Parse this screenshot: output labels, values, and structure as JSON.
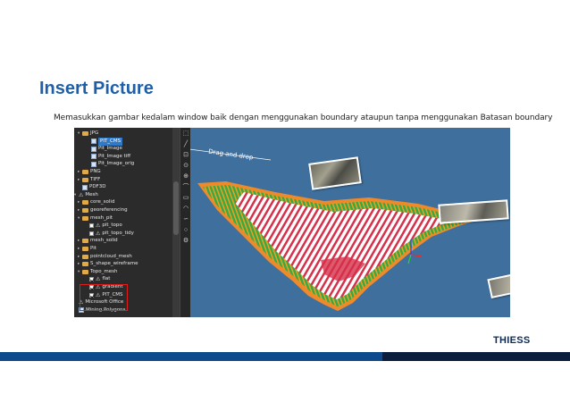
{
  "slide": {
    "title": "Insert Picture",
    "subtitle": "Memasukkan gambar kedalam window baik dengan menggunakan boundary ataupun tanpa menggunakan Batasan boundary",
    "logo": "THIESS"
  },
  "tree": {
    "items": [
      {
        "label": "JPG",
        "icon": "folder-icon",
        "arrow": "expanded"
      },
      {
        "label": "PIT_CMS",
        "icon": "image-file-icon",
        "selected": true
      },
      {
        "label": "Pit_Image",
        "icon": "image-file-icon"
      },
      {
        "label": "Pit_Image tiff",
        "icon": "image-file-icon"
      },
      {
        "label": "Pit_Image_orig",
        "icon": "image-file-icon"
      },
      {
        "label": "PNG",
        "icon": "folder-icon",
        "arrow": "collapsed"
      },
      {
        "label": "TIFF",
        "icon": "folder-icon",
        "arrow": "collapsed"
      },
      {
        "label": "PDF3D",
        "icon": "file-icon"
      },
      {
        "label": "Mesh",
        "icon": "mesh-icon",
        "arrow": "expanded"
      },
      {
        "label": "core_solid",
        "icon": "folder-icon",
        "arrow": "collapsed"
      },
      {
        "label": "georeferencing",
        "icon": "folder-icon",
        "arrow": "collapsed"
      },
      {
        "label": "mesh_pit",
        "icon": "folder-icon",
        "arrow": "expanded"
      },
      {
        "label": "pit_topo",
        "icon": "mesh-icon",
        "checkbox": false
      },
      {
        "label": "pit_topo_tidy",
        "icon": "mesh-icon",
        "checkbox": false
      },
      {
        "label": "mesh_solid",
        "icon": "folder-icon",
        "arrow": "collapsed"
      },
      {
        "label": "Pit",
        "icon": "folder-icon",
        "arrow": "collapsed"
      },
      {
        "label": "pointcloud_mesh",
        "icon": "folder-icon",
        "arrow": "collapsed"
      },
      {
        "label": "S_shape_wireframe",
        "icon": "folder-icon",
        "arrow": "collapsed"
      },
      {
        "label": "Topo_mesh",
        "icon": "folder-icon",
        "arrow": "expanded"
      },
      {
        "label": "flat",
        "icon": "mesh-icon",
        "checkbox": true
      },
      {
        "label": "gradient",
        "icon": "mesh-icon",
        "checkbox": true
      },
      {
        "label": "PIT_CMS",
        "icon": "mesh-icon",
        "checkbox": true
      },
      {
        "label": "Microsoft Office",
        "icon": "mesh-icon"
      },
      {
        "label": "Mining Polygons",
        "icon": "file-icon"
      }
    ]
  },
  "viewport": {
    "annotation": "Drag and drop",
    "background": "#3f6f9c"
  },
  "colors": {
    "title": "#1f5fa8",
    "accent_band": "#0d4a8b",
    "band_dark": "#0a1f3d",
    "highlight": "#e11c1c"
  }
}
